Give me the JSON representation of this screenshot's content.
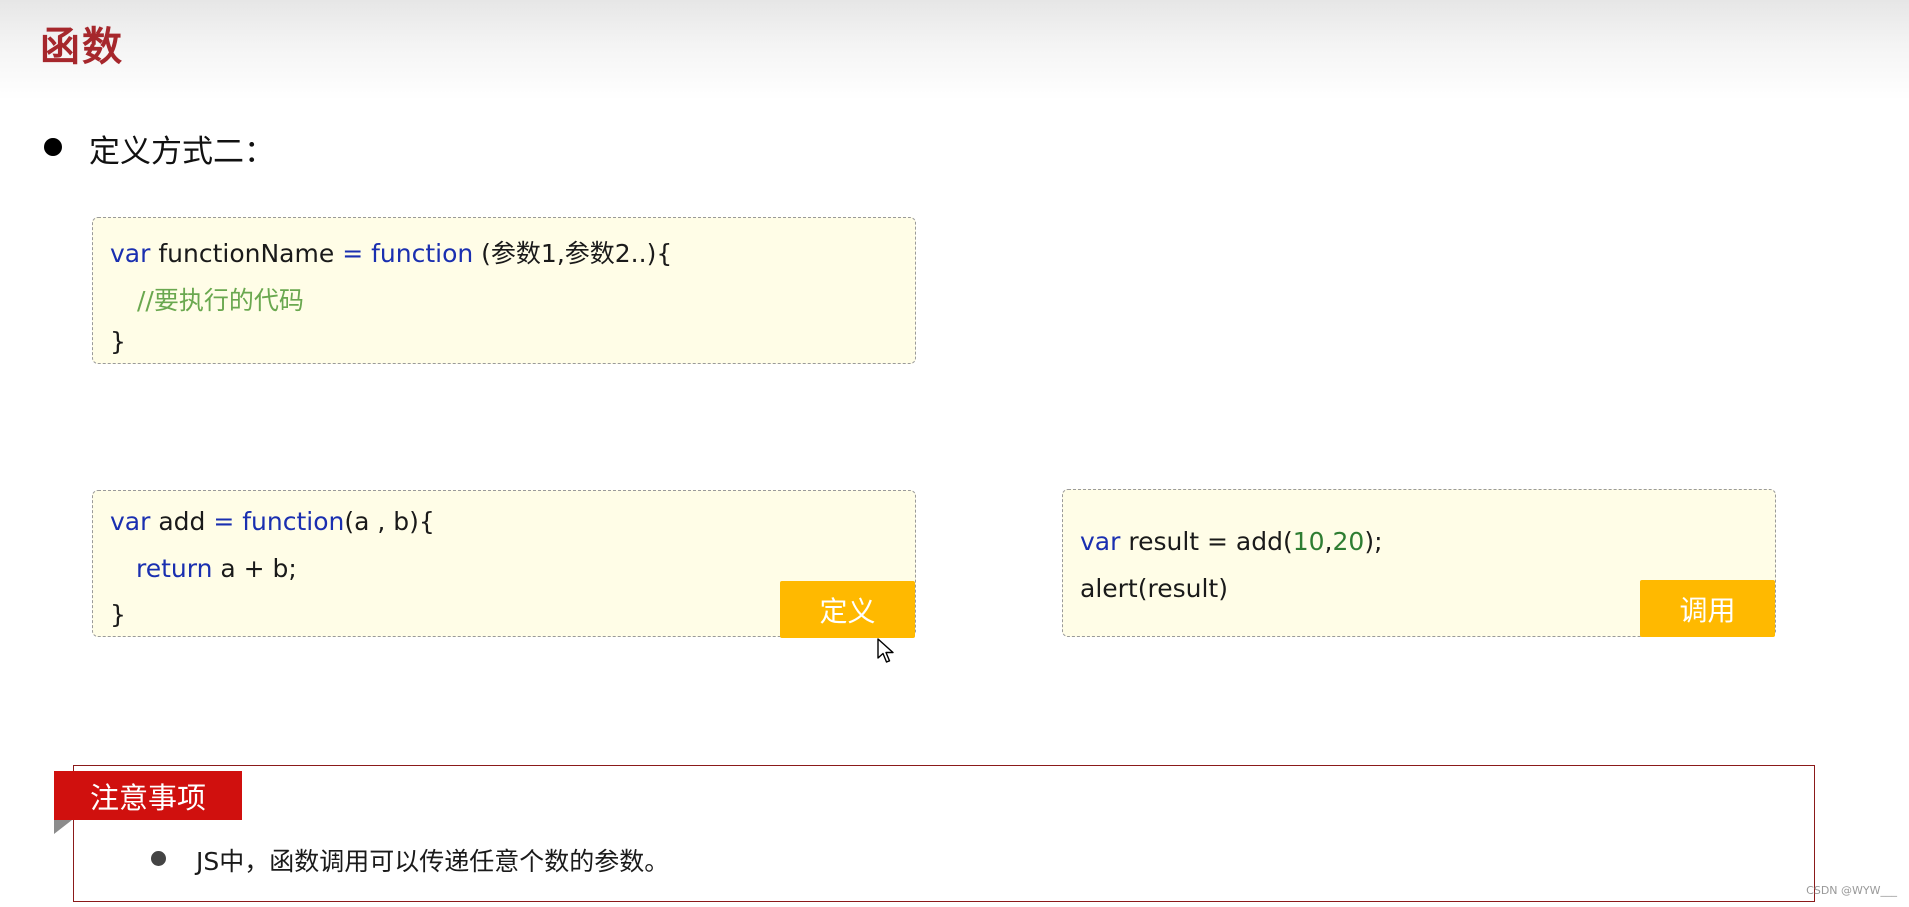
{
  "title": "函数",
  "section_heading": "定义方式二：",
  "syntax_block": {
    "line1": {
      "kw_var": "var",
      "name": " functionName ",
      "kw_eq_function": "= function",
      "params": " (参数1,参数2..){"
    },
    "line2_comment": "//要执行的代码",
    "line3": "}"
  },
  "define_block": {
    "line1": {
      "kw_var": "var",
      "name": " add ",
      "kw_eq_function": "= function",
      "params": "(a , b){"
    },
    "line2": {
      "kw_return": "return",
      "expr": " a + b;"
    },
    "line3": "}",
    "tag_label": "定义"
  },
  "call_block": {
    "line1": {
      "kw_var": "var",
      "text": " result = add(",
      "num1": "10",
      "comma": ",",
      "num2": "20",
      "close": ");"
    },
    "line2": "alert(result)",
    "tag_label": "调用"
  },
  "note": {
    "tab_label": "注意事项",
    "bullet_text": "JS中，函数调用可以传递任意个数的参数。"
  },
  "watermark": "CSDN @WYW___",
  "colors": {
    "title": "#a6272c",
    "keyword": "#1a2fb0",
    "comment": "#6aa84f",
    "number": "#2e7d32",
    "code_bg": "#fffde7",
    "tag_bg": "#ffb900",
    "note_tab_bg": "#d0100e",
    "note_border": "#8b1a1a"
  },
  "icons": {
    "cursor": "mouse-pointer-icon"
  }
}
